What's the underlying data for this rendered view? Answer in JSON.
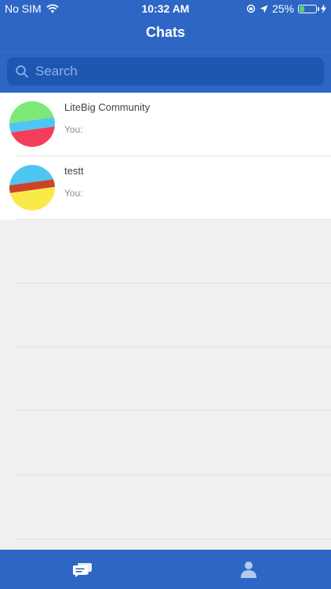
{
  "status_bar": {
    "carrier": "No SIM",
    "time": "10:32 AM",
    "battery_percent": "25%",
    "battery_level": 0.25
  },
  "header": {
    "title": "Chats"
  },
  "search": {
    "placeholder": "Search"
  },
  "chats": [
    {
      "name": "LiteBig Community",
      "preview": "You:",
      "avatar_colors": [
        "#7de878",
        "#4fc6f2",
        "#f23e5a"
      ]
    },
    {
      "name": "testt",
      "preview": "You:",
      "avatar_colors": [
        "#4fc6f2",
        "#c9452a",
        "#fbe949"
      ]
    }
  ],
  "tab_bar": {
    "tabs": [
      {
        "icon": "chat-bubbles-icon",
        "selected": true
      },
      {
        "icon": "person-icon",
        "selected": false
      }
    ]
  },
  "colors": {
    "brand_blue": "#2d66c4",
    "search_bg": "#1f56b2",
    "background": "#eff0f2"
  }
}
